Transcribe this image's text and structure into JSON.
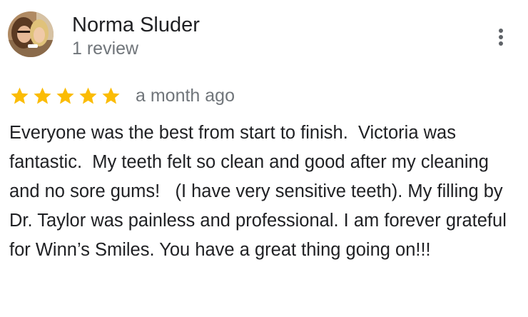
{
  "review": {
    "author_name": "Norma Sluder",
    "author_review_count": "1 review",
    "rating": 5,
    "rating_max": 5,
    "date": "a month ago",
    "text": "Everyone was the best from start to finish.  Victoria was fantastic.  My teeth felt so clean and good after my cleaning and no sore gums!   (I have very sensitive teeth). My filling by Dr. Taylor was painless and professional. I am forever grateful for Winn’s Smiles. You have a great thing going on!!!"
  },
  "icons": {
    "star": "star-icon",
    "more": "more-vert-icon",
    "avatar": "avatar-photo"
  },
  "colors": {
    "star": "#fbbc04",
    "primary_text": "#202124",
    "secondary_text": "#70757a",
    "menu_dots": "#5f6368"
  }
}
